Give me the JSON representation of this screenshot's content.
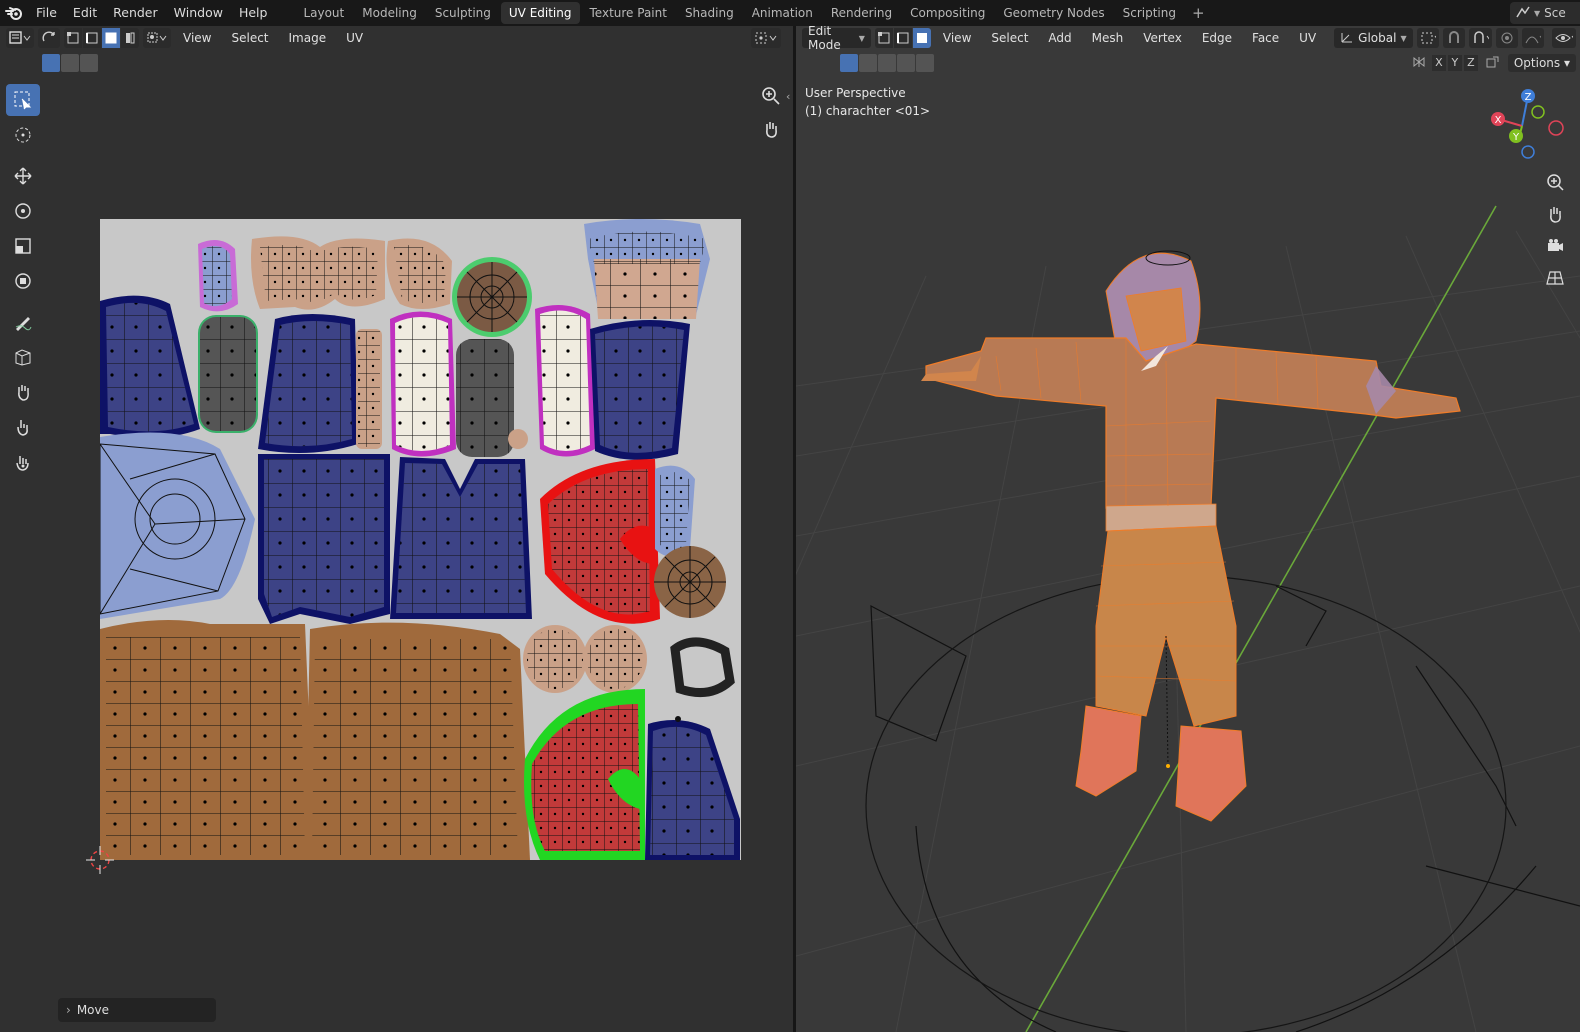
{
  "topbar": {
    "menus": [
      "File",
      "Edit",
      "Render",
      "Window",
      "Help"
    ],
    "workspaces": [
      "Layout",
      "Modeling",
      "Sculpting",
      "UV Editing",
      "Texture Paint",
      "Shading",
      "Animation",
      "Rendering",
      "Compositing",
      "Geometry Nodes",
      "Scripting"
    ],
    "active_workspace": "UV Editing",
    "add_label": "+",
    "scene_label": "Sce"
  },
  "uv_editor": {
    "menus": [
      "View",
      "Select",
      "Image",
      "UV"
    ],
    "operator_panel": "Move"
  },
  "viewport": {
    "mode": "Edit Mode",
    "menus": [
      "View",
      "Select",
      "Add",
      "Mesh",
      "Vertex",
      "Edge",
      "Face",
      "UV"
    ],
    "transform_orientation": "Global",
    "axes": [
      "X",
      "Y",
      "Z"
    ],
    "options_label": "Options",
    "overlay_line1": "User Perspective",
    "overlay_line2": "(1) charachter <01>",
    "gizmo_labels": {
      "x": "X",
      "y": "Y",
      "z": "Z"
    }
  },
  "colors": {
    "accent": "#4772b3",
    "selection_orange": "#f07c28",
    "uv_blue": "#3d4386",
    "uv_brown": "#a06a3c",
    "uv_red": "#c23a3a",
    "uv_light_blue": "#8b9ed0",
    "uv_cream": "#f0ece0",
    "uv_dark_gray": "#555555"
  }
}
